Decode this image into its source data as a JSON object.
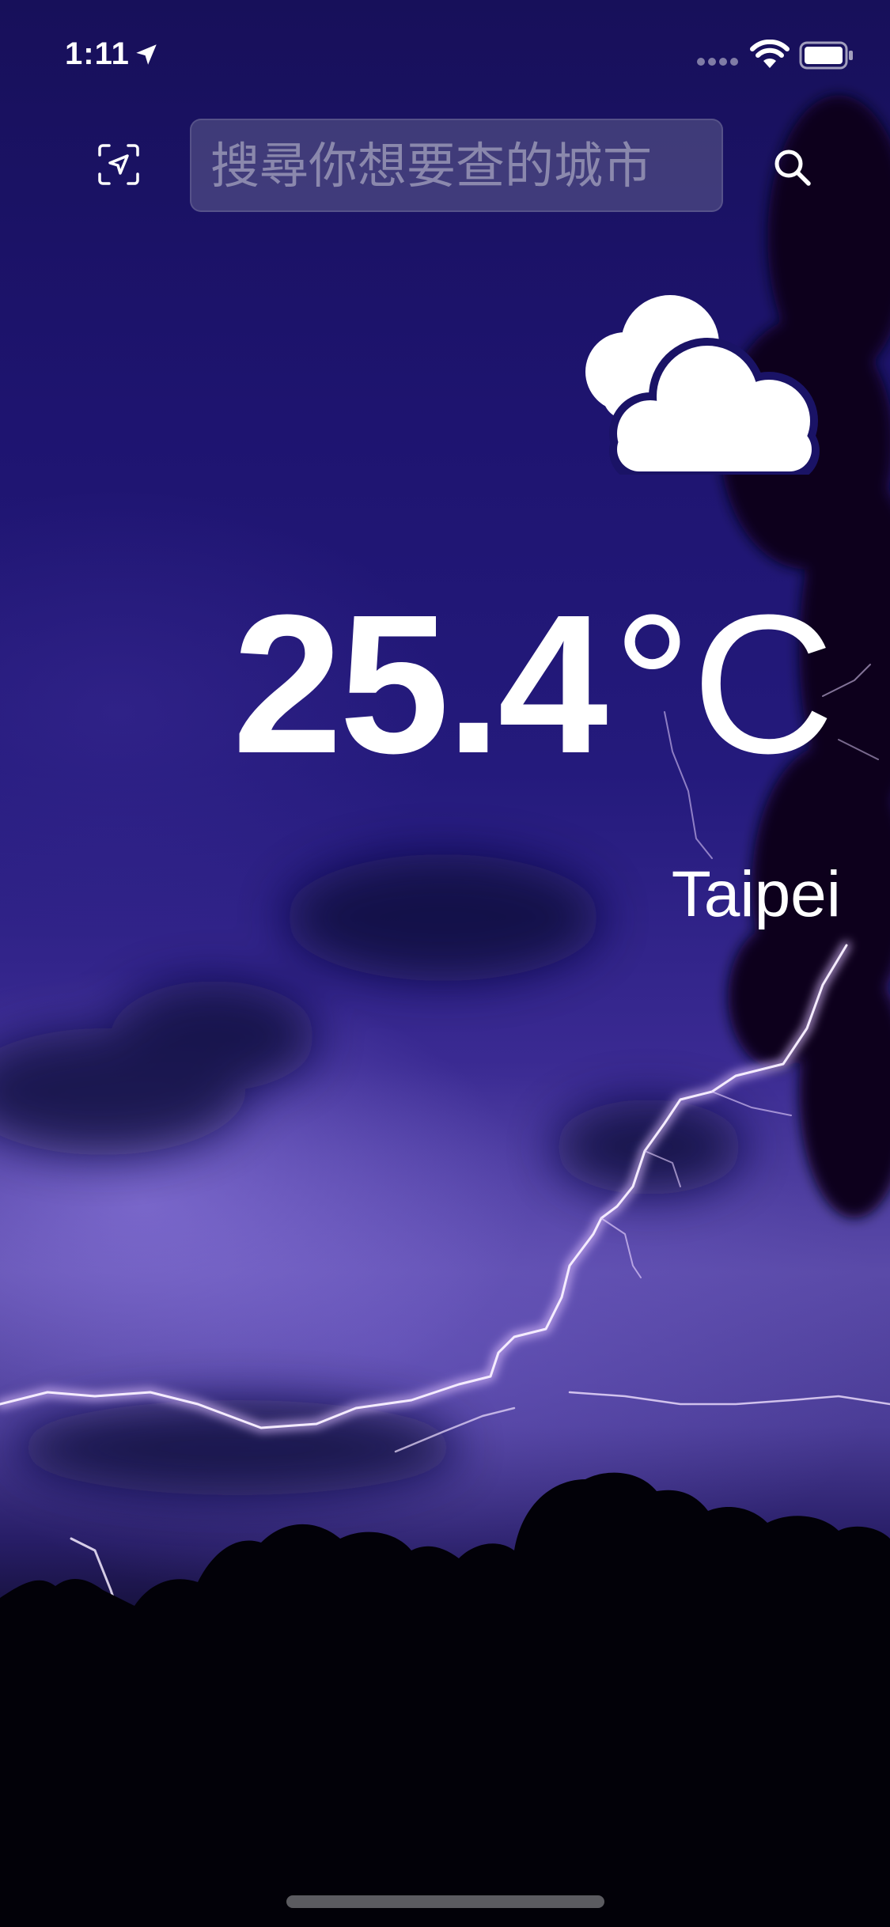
{
  "status_bar": {
    "time": "1:11",
    "location_icon": "location-arrow-icon",
    "signal_icon": "signal-dots-icon",
    "wifi_icon": "wifi-icon",
    "battery_icon": "battery-icon"
  },
  "search": {
    "locate_icon": "locate-me-icon",
    "placeholder": "搜尋你想要查的城市",
    "value": "",
    "search_icon": "magnifier-icon"
  },
  "weather": {
    "condition_icon": "cloudy-icon",
    "temperature": "25.4",
    "unit": "°C",
    "city": "Taipei"
  },
  "colors": {
    "sky_top": "#17105a",
    "sky_mid": "#5a4aa8",
    "ground": "#000000",
    "text": "#ffffff",
    "lightning": "#f2e6ff"
  }
}
